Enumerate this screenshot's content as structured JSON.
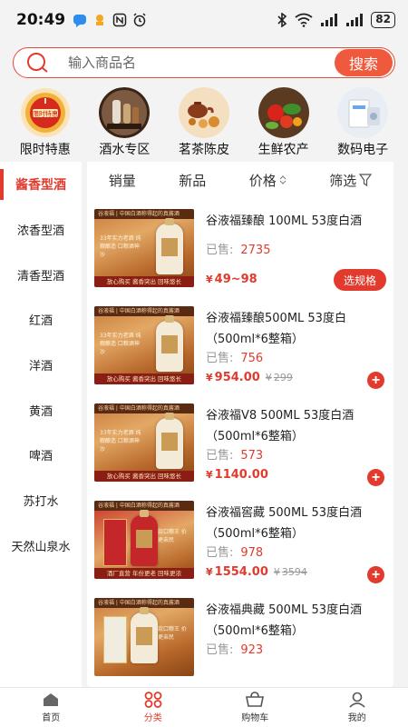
{
  "status": {
    "time": "20:49",
    "battery": "82"
  },
  "search": {
    "placeholder": "输入商品名",
    "button_label": "搜索"
  },
  "categories": [
    {
      "label": "限时特惠",
      "icon": "limited-time-clock-icon"
    },
    {
      "label": "酒水专区",
      "icon": "liquor-zone-icon"
    },
    {
      "label": "茗茶陈皮",
      "icon": "tea-icon"
    },
    {
      "label": "生鲜农产",
      "icon": "fresh-produce-icon"
    },
    {
      "label": "数码电子",
      "icon": "digital-electronics-icon"
    }
  ],
  "sidebar": {
    "items": [
      {
        "label": "酱香型酒"
      },
      {
        "label": "浓香型酒"
      },
      {
        "label": "清香型酒"
      },
      {
        "label": "红酒"
      },
      {
        "label": "洋酒"
      },
      {
        "label": "黄酒"
      },
      {
        "label": "啤酒"
      },
      {
        "label": "苏打水"
      },
      {
        "label": "天然山泉水"
      }
    ]
  },
  "sort": {
    "sales": "销量",
    "new": "新品",
    "price": "价格",
    "filter": "筛选"
  },
  "products": [
    {
      "name": "谷液福臻酿 100ML 53度白酒",
      "sold_label": "已售:",
      "sold": "2735",
      "price": "49~98",
      "old_price": "",
      "action": "选规格",
      "img_top": "谷液福 | 中国白酒称得起的真酱酒",
      "img_slogan": "33年实力老酒 纯粮酿造 口粮酒神沙",
      "img_bottom": "放心购买  酱香突出  回味悠长"
    },
    {
      "name": "谷液福臻酿500ML 53度白（500ml*6整箱）",
      "sold_label": "已售:",
      "sold": "756",
      "price": "954.00",
      "old_price": "299",
      "action": "+",
      "img_top": "谷液福 | 中国白酒称得起的真酱酒",
      "img_slogan": "33年实力老酒 纯粮酿造 口粮酒神沙",
      "img_bottom": "放心购买  酱香突出  回味悠长"
    },
    {
      "name": "谷液福V8 500ML 53度白酒（500ml*6整箱）",
      "sold_label": "已售:",
      "sold": "573",
      "price": "1140.00",
      "old_price": "",
      "action": "+",
      "img_top": "谷液福 | 中国白酒称得起的真酱酒",
      "img_slogan": "33年实力老酒 纯粮酿造 口粮酒神沙",
      "img_bottom": "放心购买  酱香突出  回味悠长"
    },
    {
      "name": "谷液福窖藏 500ML 53度白酒（500ml*6整箱）",
      "sold_label": "已售:",
      "sold": "978",
      "price": "1554.00",
      "old_price": "3594",
      "action": "+",
      "img_top": "谷液福 | 中国白酒称得起的真酱酒",
      "img_slogan": "爆款口粮王 价格更亲民",
      "img_bottom": "酒厂直营  年份更老  回味更浓"
    },
    {
      "name": "谷液福典藏 500ML 53度白酒（500ml*6整箱）",
      "sold_label": "已售:",
      "sold": "923",
      "price": "",
      "old_price": "",
      "action": "",
      "img_top": "谷液福 | 中国白酒称得起的真酱酒",
      "img_slogan": "爆款口粮王 价格更亲民",
      "img_bottom": ""
    }
  ],
  "tabbar": [
    {
      "label": "首页"
    },
    {
      "label": "分类"
    },
    {
      "label": "购物车"
    },
    {
      "label": "我的"
    }
  ],
  "colors": {
    "accent": "#e23b2e",
    "search_button": "#ef5a3f"
  }
}
